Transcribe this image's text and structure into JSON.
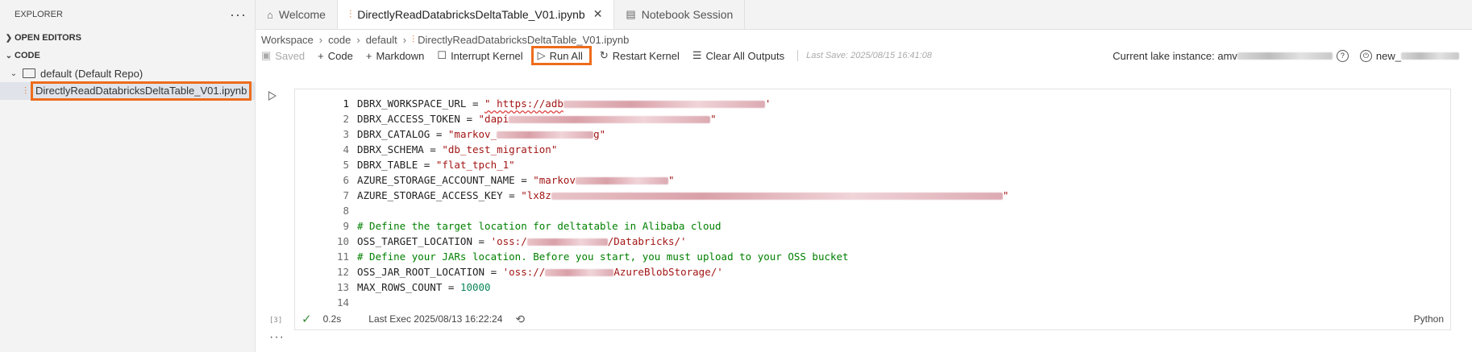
{
  "sidebar": {
    "title": "EXPLORER",
    "more": "···",
    "open_editors": "OPEN EDITORS",
    "code": "CODE",
    "repo": "default (Default Repo)",
    "file": "DirectlyReadDatabricksDeltaTable_V01.ipynb"
  },
  "tabs": [
    {
      "label": "Welcome",
      "icon": "home-icon"
    },
    {
      "label": "DirectlyReadDatabricksDeltaTable_V01.ipynb",
      "icon": "notebook-icon",
      "close": "✕"
    },
    {
      "label": "Notebook Session",
      "icon": "document-icon"
    }
  ],
  "breadcrumb": [
    "Workspace",
    "code",
    "default",
    "DirectlyReadDatabricksDeltaTable_V01.ipynb"
  ],
  "toolbar": {
    "saved": "Saved",
    "code": "Code",
    "markdown": "Markdown",
    "interrupt": "Interrupt Kernel",
    "run_all": "Run All",
    "restart": "Restart Kernel",
    "clear": "Clear All Outputs",
    "last_save": "Last Save: 2025/08/15 16:41:08",
    "lake_label": "Current lake instance: amv",
    "session_prefix": "new_"
  },
  "cell": {
    "lines": [
      {
        "n": "1",
        "a": "DBRX_WORKSPACE_URL = ",
        "s": "\" https://adb"
      },
      {
        "n": "2",
        "a": "DBRX_ACCESS_TOKEN = ",
        "s": "\"dapi"
      },
      {
        "n": "3",
        "a": "DBRX_CATALOG = ",
        "s": "\"markov_"
      },
      {
        "n": "4",
        "a": "DBRX_SCHEMA = ",
        "s": "\"db_test_migration\""
      },
      {
        "n": "5",
        "a": "DBRX_TABLE = ",
        "s": "\"flat_tpch_1\""
      },
      {
        "n": "6",
        "a": "AZURE_STORAGE_ACCOUNT_NAME = ",
        "s": "\"markov"
      },
      {
        "n": "7",
        "a": "AZURE_STORAGE_ACCESS_KEY = ",
        "s": "\"lx8z"
      },
      {
        "n": "8"
      },
      {
        "n": "9",
        "c": "# Define the target location for deltatable in Alibaba cloud"
      },
      {
        "n": "10",
        "a": "OSS_TARGET_LOCATION = ",
        "s": "'oss:/",
        "s2": "/Databricks/'"
      },
      {
        "n": "11",
        "c": "# Define your JARs location. Before you start, you must upload to your OSS bucket"
      },
      {
        "n": "12",
        "a": "OSS_JAR_ROOT_LOCATION = ",
        "s": "'oss://",
        "s2": "AzureBlobStorage/'"
      },
      {
        "n": "13",
        "a": "MAX_ROWS_COUNT = ",
        "num": "10000"
      },
      {
        "n": "14"
      }
    ],
    "exec_count": "[3]",
    "duration": "0.2s",
    "last_exec": "Last Exec 2025/08/13 16:22:24",
    "language": "Python"
  },
  "below_more": "···"
}
